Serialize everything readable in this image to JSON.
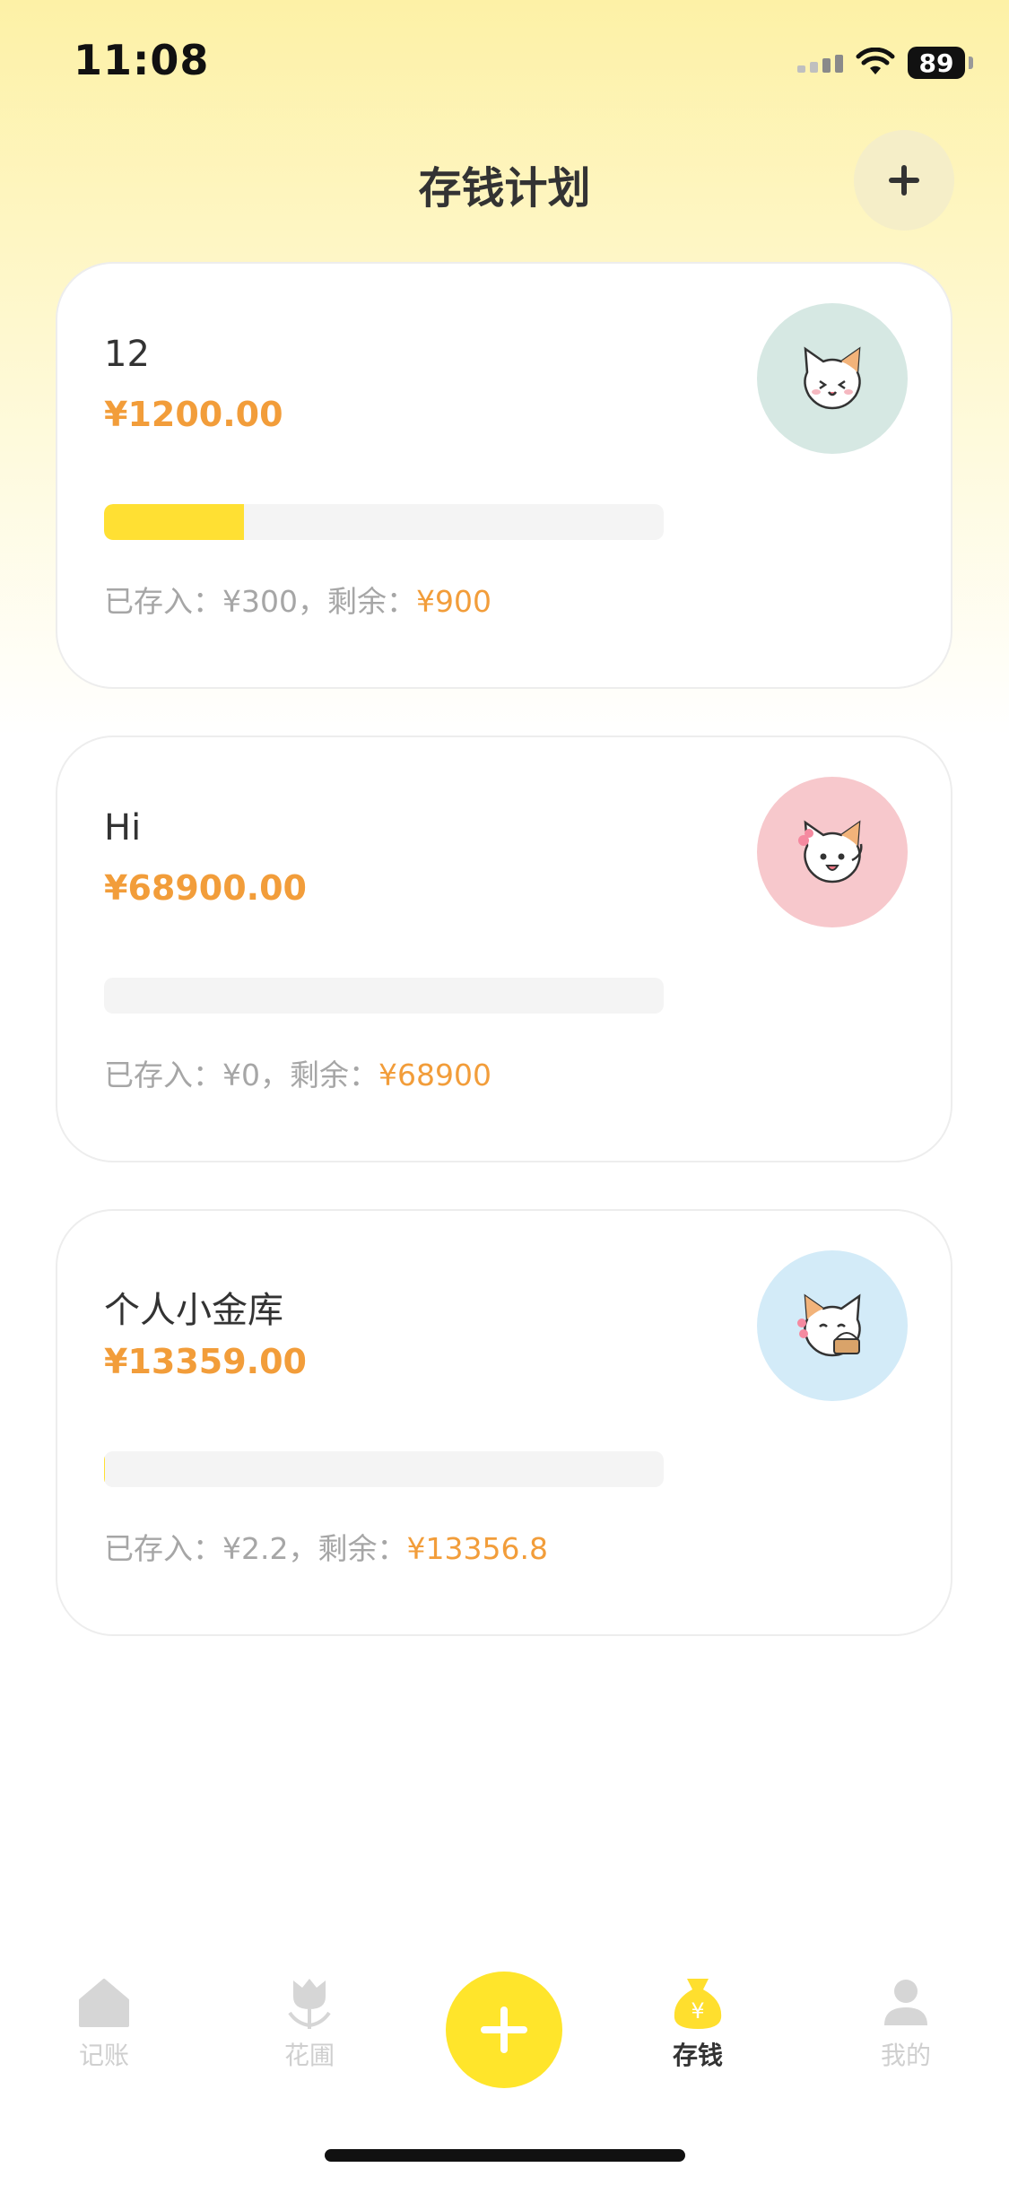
{
  "status": {
    "time": "11:08",
    "battery": "89"
  },
  "header": {
    "title": "存钱计划",
    "add_icon": "plus-icon"
  },
  "plans": [
    {
      "name": "12",
      "amount": "¥1200.00",
      "progress": 0.25,
      "saved_label": "已存入：",
      "saved": "¥300",
      "sep": "，",
      "remain_label": "剩余：",
      "remain": "¥900",
      "avatar_color": "#d6e8e3"
    },
    {
      "name": "Hi",
      "amount": "¥68900.00",
      "progress": 0,
      "saved_label": "已存入：",
      "saved": "¥0",
      "sep": "，",
      "remain_label": "剩余：",
      "remain": "¥68900",
      "avatar_color": "#f7c8cc"
    },
    {
      "name": "个人小金库",
      "amount": "¥13359.00",
      "progress": 0.0002,
      "saved_label": "已存入：",
      "saved": "¥2.2",
      "sep": "，",
      "remain_label": "剩余：",
      "remain": "¥13356.8",
      "avatar_color": "#d3ebf8"
    }
  ],
  "tabbar": {
    "tabs": [
      {
        "label": "记账",
        "icon": "home-icon"
      },
      {
        "label": "花圃",
        "icon": "tulip-icon"
      },
      {
        "label": "存钱",
        "icon": "money-bag-icon",
        "active": true
      },
      {
        "label": "我的",
        "icon": "user-icon"
      }
    ],
    "center_icon": "plus-icon"
  },
  "colors": {
    "accent": "#ffe52b",
    "amount": "#f29d3a",
    "muted": "#a6a6a6"
  }
}
